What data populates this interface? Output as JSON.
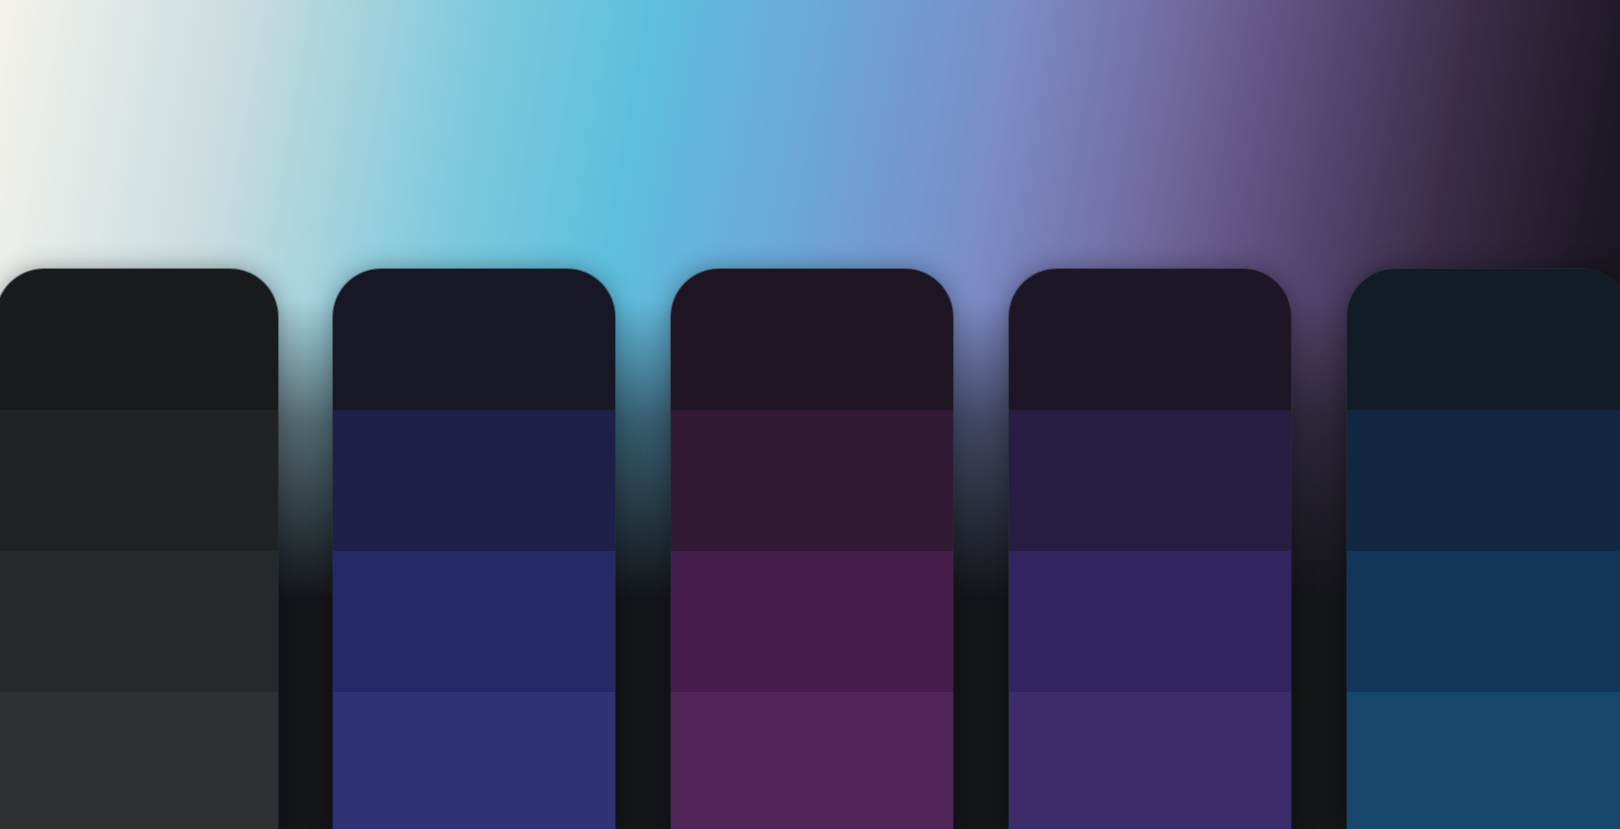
{
  "colors": {
    "background_gradient": [
      "#f4f2ec",
      "#c9dcdf",
      "#7cc9dd",
      "#5ebfdd",
      "#6aaad9",
      "#7b8cc6",
      "#726aa0",
      "#5a4b78",
      "#3a2c48",
      "#1d1824",
      "#141319"
    ],
    "background_bottom": "#141519"
  },
  "palettes": [
    {
      "shades": [
        "#181a1b",
        "#202224",
        "#25292c",
        "#2d3134"
      ]
    },
    {
      "shades": [
        "#181726",
        "#1f204a",
        "#252968",
        "#2f3375"
      ]
    },
    {
      "shades": [
        "#1f1421",
        "#321a36",
        "#451d4b",
        "#502456"
      ]
    },
    {
      "shades": [
        "#1c1626",
        "#281e43",
        "#32245e",
        "#3c2c6a"
      ]
    },
    {
      "shades": [
        "#121c27",
        "#122741",
        "#12355a",
        "#16476a"
      ]
    }
  ]
}
